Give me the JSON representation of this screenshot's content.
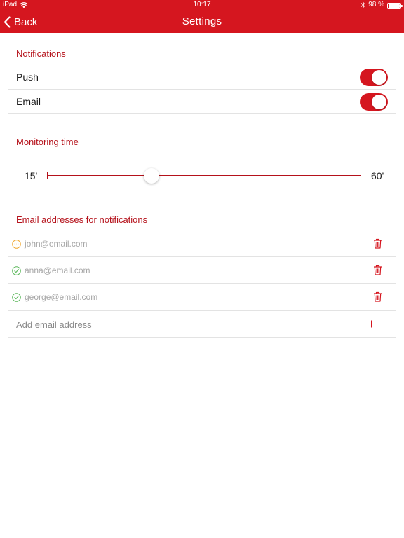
{
  "status_bar": {
    "device": "iPad",
    "time": "10:17",
    "battery": "98 %",
    "battery_level": 0.98
  },
  "nav": {
    "back_label": "Back",
    "title": "Settings"
  },
  "notifications": {
    "title": "Notifications",
    "items": [
      {
        "label": "Push",
        "enabled": true
      },
      {
        "label": "Email",
        "enabled": true
      }
    ]
  },
  "monitoring": {
    "title": "Monitoring time",
    "min_label": "15'",
    "max_label": "60'",
    "min": 15,
    "max": 60,
    "value": 30
  },
  "emails": {
    "title": "Email addresses for notifications",
    "items": [
      {
        "address": "john@email.com",
        "status": "pending",
        "status_icon": "ellipsis-circle-icon"
      },
      {
        "address": "anna@email.com",
        "status": "verified",
        "status_icon": "check-circle-icon"
      },
      {
        "address": "george@email.com",
        "status": "verified",
        "status_icon": "check-circle-icon"
      }
    ],
    "add_placeholder": "Add email address"
  },
  "colors": {
    "brand": "#d5161f",
    "section_title": "#b5121b",
    "pending": "#f0a830",
    "verified": "#5cb85c"
  }
}
